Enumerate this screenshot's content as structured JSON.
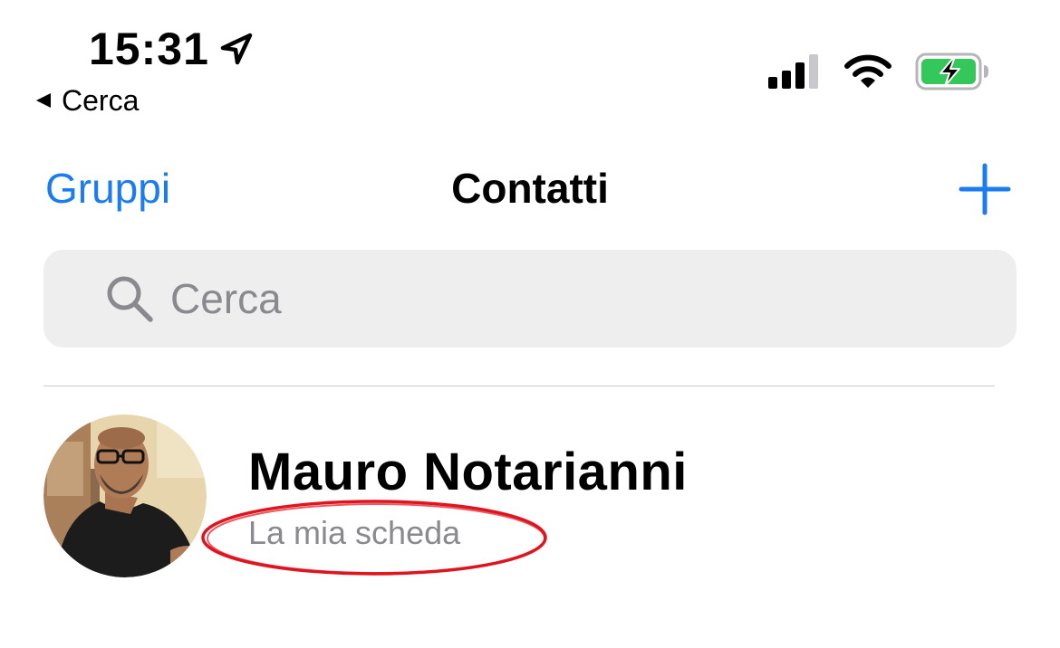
{
  "status_bar": {
    "time": "15:31",
    "back_app_label": "Cerca",
    "icons": [
      "location-arrow-icon",
      "cellular-signal-icon",
      "wifi-icon",
      "battery-charging-icon"
    ],
    "battery_color": "#34c759"
  },
  "nav": {
    "left_label": "Gruppi",
    "title": "Contatti",
    "add_icon": "plus-icon",
    "accent_color": "#1a7cf0"
  },
  "search": {
    "placeholder": "Cerca",
    "value": ""
  },
  "my_card": {
    "name": "Mauro Notarianni",
    "subtitle": "La mia scheda"
  },
  "annotation": {
    "type": "red-ellipse-highlight",
    "color": "#e0141e"
  }
}
